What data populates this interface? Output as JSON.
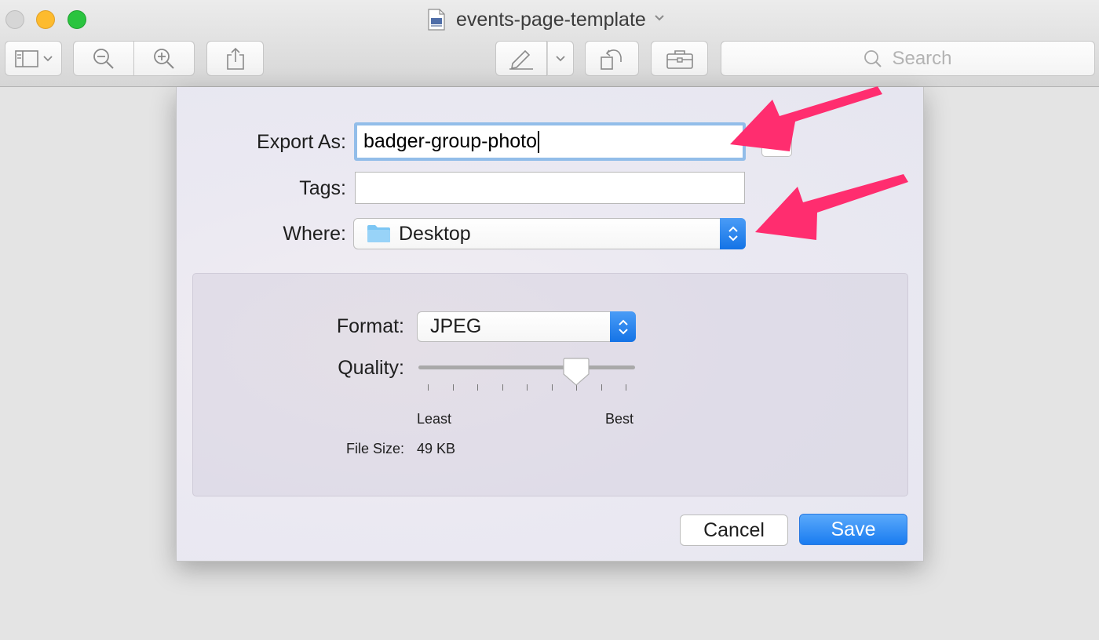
{
  "window": {
    "title": "events-page-template"
  },
  "toolbar": {
    "search_placeholder": "Search",
    "icons": [
      "sidebar-icon",
      "zoom-out-icon",
      "zoom-in-icon",
      "share-icon",
      "markup-icon",
      "rotate-icon",
      "toolbox-icon",
      "search-icon"
    ]
  },
  "dialog": {
    "export_as_label": "Export As:",
    "export_as_value": "badger-group-photo",
    "tags_label": "Tags:",
    "tags_value": "",
    "where_label": "Where:",
    "where_value": "Desktop",
    "format_label": "Format:",
    "format_value": "JPEG",
    "quality_label": "Quality:",
    "quality_level": 0.75,
    "quality_min_label": "Least",
    "quality_max_label": "Best",
    "file_size_label": "File Size:",
    "file_size_value": "49 KB",
    "cancel_label": "Cancel",
    "save_label": "Save"
  },
  "colors": {
    "accent_blue": "#1a7cf0",
    "annotation_arrow": "#ff2d6f",
    "focus_ring": "#92bde9"
  }
}
